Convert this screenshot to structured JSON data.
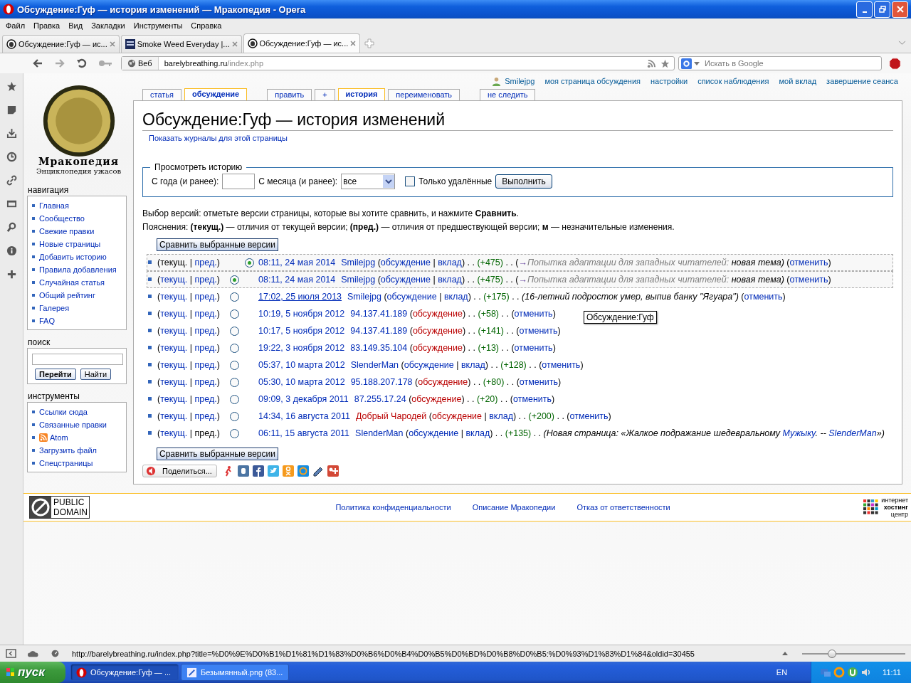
{
  "window": {
    "title": "Обсуждение:Гуф — история изменений — Мракопедия - Opera"
  },
  "menu": [
    "Файл",
    "Правка",
    "Вид",
    "Закладки",
    "Инструменты",
    "Справка"
  ],
  "tabs": [
    {
      "title": "Обсуждение:Гуф — ис...",
      "selected": false,
      "kind": "face"
    },
    {
      "title": "Smoke Weed Everyday |...",
      "selected": false,
      "kind": "meme"
    },
    {
      "title": "Обсуждение:Гуф — ис...",
      "selected": true,
      "kind": "face"
    }
  ],
  "address": {
    "badge": "Веб",
    "host": "barelybreathing.ru",
    "path": "/index.php"
  },
  "search": {
    "placeholder": "Искать в Google"
  },
  "wiki": {
    "personal": {
      "user": "Smilejpg",
      "links": [
        "моя страница обсуждения",
        "настройки",
        "список наблюдения",
        "мой вклад",
        "завершение сеанса"
      ]
    },
    "page_tabs": [
      {
        "label": "статья",
        "selected": false
      },
      {
        "label": "обсуждение",
        "selected": true
      },
      {
        "label": "править",
        "selected": false
      },
      {
        "label": "+",
        "selected": false
      },
      {
        "label": "история",
        "selected": true
      },
      {
        "label": "переименовать",
        "selected": false
      },
      {
        "label": "не следить",
        "selected": false
      }
    ],
    "logo": {
      "title": "Мракопедия",
      "subtitle": "Энциклопедия ужасов"
    },
    "sidebar": [
      {
        "kind": "links",
        "heading": "навигация",
        "items": [
          {
            "label": "Главная"
          },
          {
            "label": "Сообщество"
          },
          {
            "label": "Свежие правки"
          },
          {
            "label": "Новые страницы"
          },
          {
            "label": "Добавить историю"
          },
          {
            "label": "Правила добавления"
          },
          {
            "label": "Случайная статья"
          },
          {
            "label": "Общий рейтинг"
          },
          {
            "label": "Галерея"
          },
          {
            "label": "FAQ"
          }
        ]
      },
      {
        "kind": "search",
        "heading": "поиск",
        "buttons": [
          {
            "label": "Перейти",
            "default": true
          },
          {
            "label": "Найти",
            "default": false
          }
        ]
      },
      {
        "kind": "links",
        "heading": "инструменты",
        "items": [
          {
            "label": "Ссылки сюда"
          },
          {
            "label": "Связанные правки"
          },
          {
            "label": "Atom",
            "kind": "feed"
          },
          {
            "label": "Загрузить файл"
          },
          {
            "label": "Спецстраницы"
          }
        ]
      }
    ],
    "content": {
      "title": "Обсуждение:Гуф — история изменений",
      "logs_link": "Показать журналы для этой страницы",
      "filter": {
        "legend": "Просмотреть историю",
        "year_label": "С года (и ранее):",
        "month_label": "С месяца (и ранее):",
        "month_value": "все",
        "deleted_label": "Только удалённые",
        "deleted_checked": false,
        "submit": "Выполнить"
      },
      "intro": "Выбор версий: отметьте версии страницы, которые вы хотите сравнить, и нажмите **Сравнить**.",
      "legend": "Пояснения: **(текущ.)** — отличия от текущей версии; **(пред.)** — отличия от предшествующей версии; **м** — незначительные изменения.",
      "compare_top": "Сравнить выбранные версии",
      "rows": [
        {
          "highlighted": true,
          "radio": {
            "kind": "diff",
            "selected": true
          },
          "before": [
            {
              "t": "(текущ. | ",
              "kind": "text"
            },
            {
              "t": "пред.",
              "kind": "link"
            },
            {
              "t": ")",
              "kind": "text"
            }
          ],
          "after": [
            {
              "t": "08:11, 24 мая 2014",
              "kind": "date"
            },
            {
              "t": "Smilejpg",
              "kind": "link"
            },
            {
              "t": " (",
              "kind": "text"
            },
            {
              "t": "обсуждение",
              "kind": "link"
            },
            {
              "t": " | ",
              "kind": "text"
            },
            {
              "t": "вклад",
              "kind": "link"
            },
            {
              "t": ") . . ",
              "kind": "text"
            },
            {
              "t": "(+475)",
              "kind": "size"
            },
            {
              "t": " . . (",
              "kind": "text"
            },
            {
              "t": "→",
              "kind": "arrow"
            },
            {
              "t": "Попытка адаптации для западных читателей:",
              "kind": "auto"
            },
            {
              "t": " новая тема)",
              "kind": "em"
            },
            {
              "t": " (",
              "kind": "text"
            },
            {
              "t": "отменить",
              "kind": "link"
            },
            {
              "t": ")",
              "kind": "text"
            }
          ]
        },
        {
          "highlighted": true,
          "radio": {
            "kind": "old",
            "selected": true
          },
          "before": [
            {
              "t": "(",
              "kind": "text"
            },
            {
              "t": "текущ.",
              "kind": "link"
            },
            {
              "t": " | ",
              "kind": "text"
            },
            {
              "t": "пред.",
              "kind": "link"
            },
            {
              "t": ")",
              "kind": "text"
            }
          ],
          "after": [
            {
              "t": "08:11, 24 мая 2014",
              "kind": "date"
            },
            {
              "t": "Smilejpg",
              "kind": "link"
            },
            {
              "t": " (",
              "kind": "text"
            },
            {
              "t": "обсуждение",
              "kind": "link"
            },
            {
              "t": " | ",
              "kind": "text"
            },
            {
              "t": "вклад",
              "kind": "link"
            },
            {
              "t": ") . . ",
              "kind": "text"
            },
            {
              "t": "(+475)",
              "kind": "size"
            },
            {
              "t": " . . (",
              "kind": "text"
            },
            {
              "t": "→",
              "kind": "arrow"
            },
            {
              "t": "Попытка адаптации для западных читателей:",
              "kind": "auto"
            },
            {
              "t": " новая тема)",
              "kind": "em"
            },
            {
              "t": " (",
              "kind": "text"
            },
            {
              "t": "отменить",
              "kind": "link"
            },
            {
              "t": ")",
              "kind": "text"
            }
          ]
        },
        {
          "highlighted": false,
          "radio": {
            "kind": "old",
            "selected": false
          },
          "before": [
            {
              "t": "(",
              "kind": "text"
            },
            {
              "t": "текущ.",
              "kind": "link"
            },
            {
              "t": " | ",
              "kind": "text"
            },
            {
              "t": "пред.",
              "kind": "link"
            },
            {
              "t": ")",
              "kind": "text"
            }
          ],
          "after": [
            {
              "t": "17:02, 25 июля 2013",
              "kind": "datehover"
            },
            {
              "t": "Smilejpg",
              "kind": "link"
            },
            {
              "t": " (",
              "kind": "text"
            },
            {
              "t": "обсуждение",
              "kind": "link"
            },
            {
              "t": " | ",
              "kind": "text"
            },
            {
              "t": "вклад",
              "kind": "link"
            },
            {
              "t": ") . . ",
              "kind": "text"
            },
            {
              "t": "(+175)",
              "kind": "size"
            },
            {
              "t": " . . ",
              "kind": "text"
            },
            {
              "t": "(16-летний подросток умер, выпив банку \"Ягуара\")",
              "kind": "em"
            },
            {
              "t": " (",
              "kind": "text"
            },
            {
              "t": "отменить",
              "kind": "link"
            },
            {
              "t": ")",
              "kind": "text"
            }
          ]
        },
        {
          "highlighted": false,
          "radio": {
            "kind": "old",
            "selected": false
          },
          "before": [
            {
              "t": "(",
              "kind": "text"
            },
            {
              "t": "текущ.",
              "kind": "link"
            },
            {
              "t": " | ",
              "kind": "text"
            },
            {
              "t": "пред.",
              "kind": "link"
            },
            {
              "t": ")",
              "kind": "text"
            }
          ],
          "after": [
            {
              "t": "10:19, 5 ноября 2012",
              "kind": "date"
            },
            {
              "t": "94.137.41.189",
              "kind": "link"
            },
            {
              "t": " (",
              "kind": "text"
            },
            {
              "t": "обсуждение",
              "kind": "new"
            },
            {
              "t": ") . . ",
              "kind": "text"
            },
            {
              "t": "(+58)",
              "kind": "size"
            },
            {
              "t": " . . (",
              "kind": "text"
            },
            {
              "t": "отменить",
              "kind": "link"
            },
            {
              "t": ")",
              "kind": "text"
            }
          ]
        },
        {
          "highlighted": false,
          "radio": {
            "kind": "old",
            "selected": false
          },
          "before": [
            {
              "t": "(",
              "kind": "text"
            },
            {
              "t": "текущ.",
              "kind": "link"
            },
            {
              "t": " | ",
              "kind": "text"
            },
            {
              "t": "пред.",
              "kind": "link"
            },
            {
              "t": ")",
              "kind": "text"
            }
          ],
          "after": [
            {
              "t": "10:17, 5 ноября 2012",
              "kind": "date"
            },
            {
              "t": "94.137.41.189",
              "kind": "link"
            },
            {
              "t": " (",
              "kind": "text"
            },
            {
              "t": "обсуждение",
              "kind": "new"
            },
            {
              "t": ") . . ",
              "kind": "text"
            },
            {
              "t": "(+141)",
              "kind": "size"
            },
            {
              "t": " . . (",
              "kind": "text"
            },
            {
              "t": "отменить",
              "kind": "link"
            },
            {
              "t": ")",
              "kind": "text"
            }
          ]
        },
        {
          "highlighted": false,
          "radio": {
            "kind": "old",
            "selected": false
          },
          "before": [
            {
              "t": "(",
              "kind": "text"
            },
            {
              "t": "текущ.",
              "kind": "link"
            },
            {
              "t": " | ",
              "kind": "text"
            },
            {
              "t": "пред.",
              "kind": "link"
            },
            {
              "t": ")",
              "kind": "text"
            }
          ],
          "after": [
            {
              "t": "19:22, 3 ноября 2012",
              "kind": "date"
            },
            {
              "t": "83.149.35.104",
              "kind": "link"
            },
            {
              "t": " (",
              "kind": "text"
            },
            {
              "t": "обсуждение",
              "kind": "new"
            },
            {
              "t": ") . . ",
              "kind": "text"
            },
            {
              "t": "(+13)",
              "kind": "size"
            },
            {
              "t": " . . (",
              "kind": "text"
            },
            {
              "t": "отменить",
              "kind": "link"
            },
            {
              "t": ")",
              "kind": "text"
            }
          ]
        },
        {
          "highlighted": false,
          "radio": {
            "kind": "old",
            "selected": false
          },
          "before": [
            {
              "t": "(",
              "kind": "text"
            },
            {
              "t": "текущ.",
              "kind": "link"
            },
            {
              "t": " | ",
              "kind": "text"
            },
            {
              "t": "пред.",
              "kind": "link"
            },
            {
              "t": ")",
              "kind": "text"
            }
          ],
          "after": [
            {
              "t": "05:37, 10 марта 2012",
              "kind": "date"
            },
            {
              "t": "SlenderMan",
              "kind": "link"
            },
            {
              "t": " (",
              "kind": "text"
            },
            {
              "t": "обсуждение",
              "kind": "link"
            },
            {
              "t": " | ",
              "kind": "text"
            },
            {
              "t": "вклад",
              "kind": "link"
            },
            {
              "t": ") . . ",
              "kind": "text"
            },
            {
              "t": "(+128)",
              "kind": "size"
            },
            {
              "t": " . . (",
              "kind": "text"
            },
            {
              "t": "отменить",
              "kind": "link"
            },
            {
              "t": ")",
              "kind": "text"
            }
          ]
        },
        {
          "highlighted": false,
          "radio": {
            "kind": "old",
            "selected": false
          },
          "before": [
            {
              "t": "(",
              "kind": "text"
            },
            {
              "t": "текущ.",
              "kind": "link"
            },
            {
              "t": " | ",
              "kind": "text"
            },
            {
              "t": "пред.",
              "kind": "link"
            },
            {
              "t": ")",
              "kind": "text"
            }
          ],
          "after": [
            {
              "t": "05:30, 10 марта 2012",
              "kind": "date"
            },
            {
              "t": "95.188.207.178",
              "kind": "link"
            },
            {
              "t": " (",
              "kind": "text"
            },
            {
              "t": "обсуждение",
              "kind": "new"
            },
            {
              "t": ") . . ",
              "kind": "text"
            },
            {
              "t": "(+80)",
              "kind": "size"
            },
            {
              "t": " . . (",
              "kind": "text"
            },
            {
              "t": "отменить",
              "kind": "link"
            },
            {
              "t": ")",
              "kind": "text"
            }
          ]
        },
        {
          "highlighted": false,
          "radio": {
            "kind": "old",
            "selected": false
          },
          "before": [
            {
              "t": "(",
              "kind": "text"
            },
            {
              "t": "текущ.",
              "kind": "link"
            },
            {
              "t": " | ",
              "kind": "text"
            },
            {
              "t": "пред.",
              "kind": "link"
            },
            {
              "t": ")",
              "kind": "text"
            }
          ],
          "after": [
            {
              "t": "09:09, 3 декабря 2011",
              "kind": "date"
            },
            {
              "t": "87.255.17.24",
              "kind": "link"
            },
            {
              "t": " (",
              "kind": "text"
            },
            {
              "t": "обсуждение",
              "kind": "new"
            },
            {
              "t": ") . . ",
              "kind": "text"
            },
            {
              "t": "(+20)",
              "kind": "size"
            },
            {
              "t": " . . (",
              "kind": "text"
            },
            {
              "t": "отменить",
              "kind": "link"
            },
            {
              "t": ")",
              "kind": "text"
            }
          ]
        },
        {
          "highlighted": false,
          "radio": {
            "kind": "old",
            "selected": false
          },
          "before": [
            {
              "t": "(",
              "kind": "text"
            },
            {
              "t": "текущ.",
              "kind": "link"
            },
            {
              "t": " | ",
              "kind": "text"
            },
            {
              "t": "пред.",
              "kind": "link"
            },
            {
              "t": ")",
              "kind": "text"
            }
          ],
          "after": [
            {
              "t": "14:34, 16 августа 2011",
              "kind": "date"
            },
            {
              "t": "Добрый Чародей",
              "kind": "new"
            },
            {
              "t": " (",
              "kind": "text"
            },
            {
              "t": "обсуждение",
              "kind": "new"
            },
            {
              "t": " | ",
              "kind": "text"
            },
            {
              "t": "вклад",
              "kind": "link"
            },
            {
              "t": ") . . ",
              "kind": "text"
            },
            {
              "t": "(+200)",
              "kind": "size"
            },
            {
              "t": " . . (",
              "kind": "text"
            },
            {
              "t": "отменить",
              "kind": "link"
            },
            {
              "t": ")",
              "kind": "text"
            }
          ]
        },
        {
          "highlighted": false,
          "radio": {
            "kind": "old",
            "selected": false
          },
          "before": [
            {
              "t": "(",
              "kind": "text"
            },
            {
              "t": "текущ.",
              "kind": "link"
            },
            {
              "t": " | пред.)",
              "kind": "text"
            }
          ],
          "after": [
            {
              "t": "06:11, 15 августа 2011",
              "kind": "date"
            },
            {
              "t": "SlenderMan",
              "kind": "link"
            },
            {
              "t": " (",
              "kind": "text"
            },
            {
              "t": "обсуждение",
              "kind": "link"
            },
            {
              "t": " | ",
              "kind": "text"
            },
            {
              "t": "вклад",
              "kind": "link"
            },
            {
              "t": ") . . ",
              "kind": "text"
            },
            {
              "t": "(+135)",
              "kind": "size"
            },
            {
              "t": " . . ",
              "kind": "text"
            },
            {
              "t": "(Новая страница: «Жалкое подражание шедевральному ",
              "kind": "em"
            },
            {
              "t": "Мужыку",
              "kind": "emlink"
            },
            {
              "t": ". -- ",
              "kind": "em"
            },
            {
              "t": "SlenderMan",
              "kind": "emlink"
            },
            {
              "t": "»)",
              "kind": "em"
            }
          ]
        }
      ],
      "compare_bottom": "Сравнить выбранные версии",
      "share": "Поделиться..."
    },
    "tooltip": "Обсуждение:Гуф",
    "footer": {
      "license": [
        "PUBLIC",
        "DOMAIN"
      ],
      "links": [
        "Политика конфиденциальности",
        "Описание Мракопедии",
        "Отказ от ответственности"
      ],
      "hosting": [
        "интернет",
        "хостинг",
        "центр"
      ]
    }
  },
  "status_bar": {
    "url": "http://barelybreathing.ru/index.php?title=%D0%9E%D0%B1%D1%81%D1%83%D0%B6%D0%B4%D0%B5%D0%BD%D0%B8%D0%B5:%D0%93%D1%83%D1%84&oldid=30455",
    "zoom": {
      "level": 0.28
    }
  },
  "taskbar": {
    "start": "пуск",
    "tasks": [
      {
        "title": "Обсуждение:Гуф — ...",
        "selected": true,
        "kind": "opera"
      },
      {
        "title": "Безымянный.png (83...",
        "selected": false,
        "kind": "paint"
      }
    ],
    "language": "EN",
    "clock": "11:11"
  }
}
